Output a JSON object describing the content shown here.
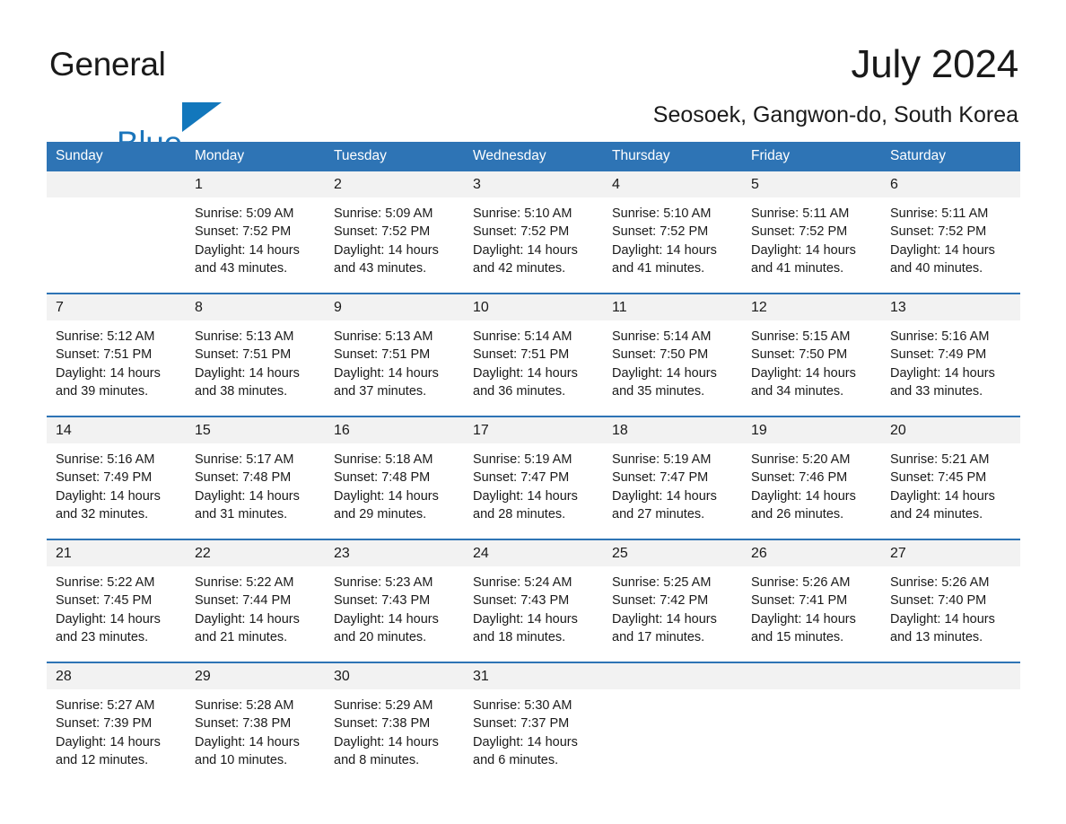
{
  "brand": {
    "line1": "General",
    "line2": "Blue",
    "triangle_color": "#1277bc"
  },
  "header": {
    "month_title": "July 2024",
    "location": "Seosoek, Gangwon-do, South Korea"
  },
  "theme": {
    "header_blue": "#2e74b5",
    "number_strip_gray": "#f2f2f2",
    "text_color": "#1a1a1a"
  },
  "calendar": {
    "day_headers": [
      "Sunday",
      "Monday",
      "Tuesday",
      "Wednesday",
      "Thursday",
      "Friday",
      "Saturday"
    ],
    "weeks": [
      {
        "days": [
          {
            "num": "",
            "sunrise": "",
            "sunset": "",
            "daylight_1": "",
            "daylight_2": ""
          },
          {
            "num": "1",
            "sunrise": "Sunrise: 5:09 AM",
            "sunset": "Sunset: 7:52 PM",
            "daylight_1": "Daylight: 14 hours",
            "daylight_2": "and 43 minutes."
          },
          {
            "num": "2",
            "sunrise": "Sunrise: 5:09 AM",
            "sunset": "Sunset: 7:52 PM",
            "daylight_1": "Daylight: 14 hours",
            "daylight_2": "and 43 minutes."
          },
          {
            "num": "3",
            "sunrise": "Sunrise: 5:10 AM",
            "sunset": "Sunset: 7:52 PM",
            "daylight_1": "Daylight: 14 hours",
            "daylight_2": "and 42 minutes."
          },
          {
            "num": "4",
            "sunrise": "Sunrise: 5:10 AM",
            "sunset": "Sunset: 7:52 PM",
            "daylight_1": "Daylight: 14 hours",
            "daylight_2": "and 41 minutes."
          },
          {
            "num": "5",
            "sunrise": "Sunrise: 5:11 AM",
            "sunset": "Sunset: 7:52 PM",
            "daylight_1": "Daylight: 14 hours",
            "daylight_2": "and 41 minutes."
          },
          {
            "num": "6",
            "sunrise": "Sunrise: 5:11 AM",
            "sunset": "Sunset: 7:52 PM",
            "daylight_1": "Daylight: 14 hours",
            "daylight_2": "and 40 minutes."
          }
        ]
      },
      {
        "days": [
          {
            "num": "7",
            "sunrise": "Sunrise: 5:12 AM",
            "sunset": "Sunset: 7:51 PM",
            "daylight_1": "Daylight: 14 hours",
            "daylight_2": "and 39 minutes."
          },
          {
            "num": "8",
            "sunrise": "Sunrise: 5:13 AM",
            "sunset": "Sunset: 7:51 PM",
            "daylight_1": "Daylight: 14 hours",
            "daylight_2": "and 38 minutes."
          },
          {
            "num": "9",
            "sunrise": "Sunrise: 5:13 AM",
            "sunset": "Sunset: 7:51 PM",
            "daylight_1": "Daylight: 14 hours",
            "daylight_2": "and 37 minutes."
          },
          {
            "num": "10",
            "sunrise": "Sunrise: 5:14 AM",
            "sunset": "Sunset: 7:51 PM",
            "daylight_1": "Daylight: 14 hours",
            "daylight_2": "and 36 minutes."
          },
          {
            "num": "11",
            "sunrise": "Sunrise: 5:14 AM",
            "sunset": "Sunset: 7:50 PM",
            "daylight_1": "Daylight: 14 hours",
            "daylight_2": "and 35 minutes."
          },
          {
            "num": "12",
            "sunrise": "Sunrise: 5:15 AM",
            "sunset": "Sunset: 7:50 PM",
            "daylight_1": "Daylight: 14 hours",
            "daylight_2": "and 34 minutes."
          },
          {
            "num": "13",
            "sunrise": "Sunrise: 5:16 AM",
            "sunset": "Sunset: 7:49 PM",
            "daylight_1": "Daylight: 14 hours",
            "daylight_2": "and 33 minutes."
          }
        ]
      },
      {
        "days": [
          {
            "num": "14",
            "sunrise": "Sunrise: 5:16 AM",
            "sunset": "Sunset: 7:49 PM",
            "daylight_1": "Daylight: 14 hours",
            "daylight_2": "and 32 minutes."
          },
          {
            "num": "15",
            "sunrise": "Sunrise: 5:17 AM",
            "sunset": "Sunset: 7:48 PM",
            "daylight_1": "Daylight: 14 hours",
            "daylight_2": "and 31 minutes."
          },
          {
            "num": "16",
            "sunrise": "Sunrise: 5:18 AM",
            "sunset": "Sunset: 7:48 PM",
            "daylight_1": "Daylight: 14 hours",
            "daylight_2": "and 29 minutes."
          },
          {
            "num": "17",
            "sunrise": "Sunrise: 5:19 AM",
            "sunset": "Sunset: 7:47 PM",
            "daylight_1": "Daylight: 14 hours",
            "daylight_2": "and 28 minutes."
          },
          {
            "num": "18",
            "sunrise": "Sunrise: 5:19 AM",
            "sunset": "Sunset: 7:47 PM",
            "daylight_1": "Daylight: 14 hours",
            "daylight_2": "and 27 minutes."
          },
          {
            "num": "19",
            "sunrise": "Sunrise: 5:20 AM",
            "sunset": "Sunset: 7:46 PM",
            "daylight_1": "Daylight: 14 hours",
            "daylight_2": "and 26 minutes."
          },
          {
            "num": "20",
            "sunrise": "Sunrise: 5:21 AM",
            "sunset": "Sunset: 7:45 PM",
            "daylight_1": "Daylight: 14 hours",
            "daylight_2": "and 24 minutes."
          }
        ]
      },
      {
        "days": [
          {
            "num": "21",
            "sunrise": "Sunrise: 5:22 AM",
            "sunset": "Sunset: 7:45 PM",
            "daylight_1": "Daylight: 14 hours",
            "daylight_2": "and 23 minutes."
          },
          {
            "num": "22",
            "sunrise": "Sunrise: 5:22 AM",
            "sunset": "Sunset: 7:44 PM",
            "daylight_1": "Daylight: 14 hours",
            "daylight_2": "and 21 minutes."
          },
          {
            "num": "23",
            "sunrise": "Sunrise: 5:23 AM",
            "sunset": "Sunset: 7:43 PM",
            "daylight_1": "Daylight: 14 hours",
            "daylight_2": "and 20 minutes."
          },
          {
            "num": "24",
            "sunrise": "Sunrise: 5:24 AM",
            "sunset": "Sunset: 7:43 PM",
            "daylight_1": "Daylight: 14 hours",
            "daylight_2": "and 18 minutes."
          },
          {
            "num": "25",
            "sunrise": "Sunrise: 5:25 AM",
            "sunset": "Sunset: 7:42 PM",
            "daylight_1": "Daylight: 14 hours",
            "daylight_2": "and 17 minutes."
          },
          {
            "num": "26",
            "sunrise": "Sunrise: 5:26 AM",
            "sunset": "Sunset: 7:41 PM",
            "daylight_1": "Daylight: 14 hours",
            "daylight_2": "and 15 minutes."
          },
          {
            "num": "27",
            "sunrise": "Sunrise: 5:26 AM",
            "sunset": "Sunset: 7:40 PM",
            "daylight_1": "Daylight: 14 hours",
            "daylight_2": "and 13 minutes."
          }
        ]
      },
      {
        "days": [
          {
            "num": "28",
            "sunrise": "Sunrise: 5:27 AM",
            "sunset": "Sunset: 7:39 PM",
            "daylight_1": "Daylight: 14 hours",
            "daylight_2": "and 12 minutes."
          },
          {
            "num": "29",
            "sunrise": "Sunrise: 5:28 AM",
            "sunset": "Sunset: 7:38 PM",
            "daylight_1": "Daylight: 14 hours",
            "daylight_2": "and 10 minutes."
          },
          {
            "num": "30",
            "sunrise": "Sunrise: 5:29 AM",
            "sunset": "Sunset: 7:38 PM",
            "daylight_1": "Daylight: 14 hours",
            "daylight_2": "and 8 minutes."
          },
          {
            "num": "31",
            "sunrise": "Sunrise: 5:30 AM",
            "sunset": "Sunset: 7:37 PM",
            "daylight_1": "Daylight: 14 hours",
            "daylight_2": "and 6 minutes."
          },
          {
            "num": "",
            "sunrise": "",
            "sunset": "",
            "daylight_1": "",
            "daylight_2": ""
          },
          {
            "num": "",
            "sunrise": "",
            "sunset": "",
            "daylight_1": "",
            "daylight_2": ""
          },
          {
            "num": "",
            "sunrise": "",
            "sunset": "",
            "daylight_1": "",
            "daylight_2": ""
          }
        ]
      }
    ]
  }
}
